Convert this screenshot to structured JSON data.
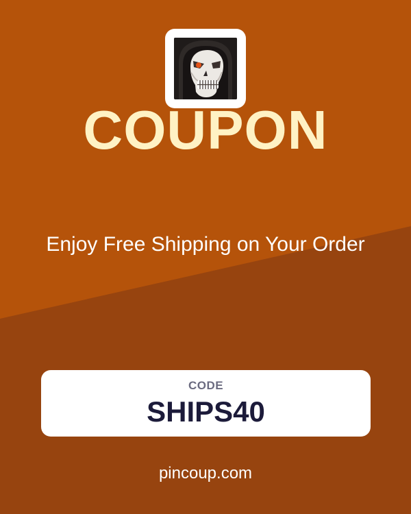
{
  "colors": {
    "background_upper": "#b5530a",
    "background_lower": "#97440f",
    "title": "#fff2c4",
    "code_card": "#ffffff",
    "code_text": "#1c1b3a",
    "code_label": "#6b6b80"
  },
  "logo": {
    "icon": "skull-reaper-icon"
  },
  "coupon": {
    "title": "COUPON",
    "offer": "Enjoy Free Shipping on Your Order",
    "code_label": "CODE",
    "code": "SHIPS40"
  },
  "footer": {
    "website": "pincoup.com"
  }
}
